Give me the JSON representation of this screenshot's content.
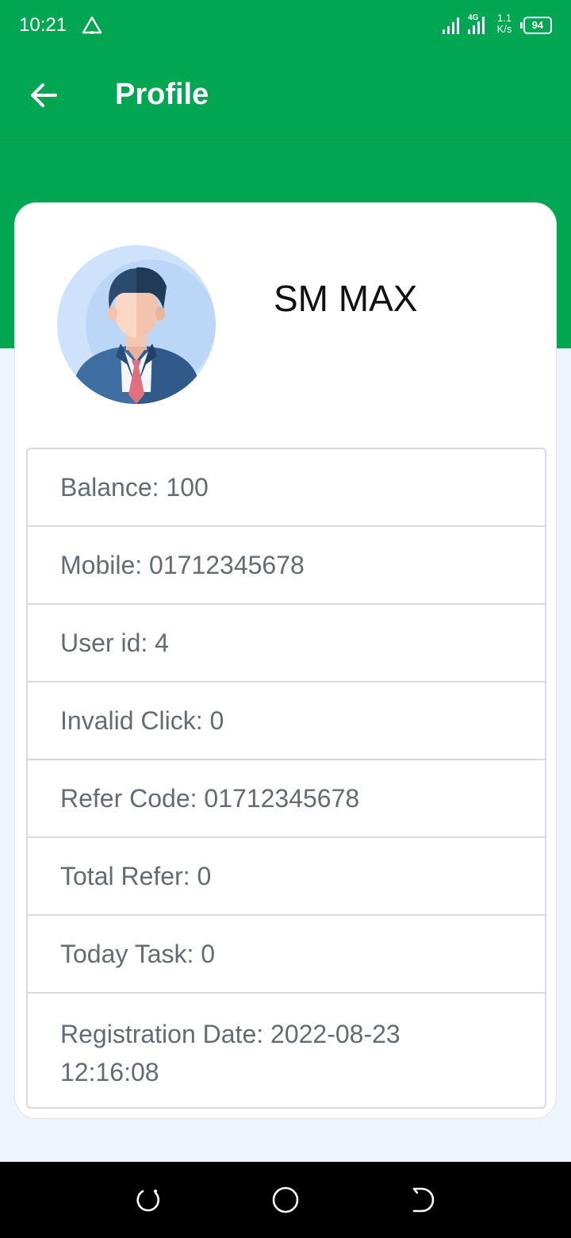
{
  "status_bar": {
    "time": "10:21",
    "net_speed_value": "1.1",
    "net_speed_unit": "K/s",
    "battery": "94",
    "network_type": "4G"
  },
  "app_bar": {
    "title": "Profile"
  },
  "profile": {
    "name": "SM MAX"
  },
  "info_rows": [
    "Balance: 100",
    "Mobile: 01712345678",
    "User id: 4",
    "Invalid Click: 0",
    "Refer Code: 01712345678",
    "Total Refer: 0",
    "Today Task: 0",
    "Registration Date: 2022-08-23 12:16:08"
  ],
  "colors": {
    "primary": "#00a651",
    "background": "#eef4fb",
    "row_text": "#636b74"
  },
  "icons": {
    "back": "arrow-left-icon",
    "nav_recent": "recent-apps-icon",
    "nav_home": "home-circle-icon",
    "nav_back": "back-icon"
  }
}
